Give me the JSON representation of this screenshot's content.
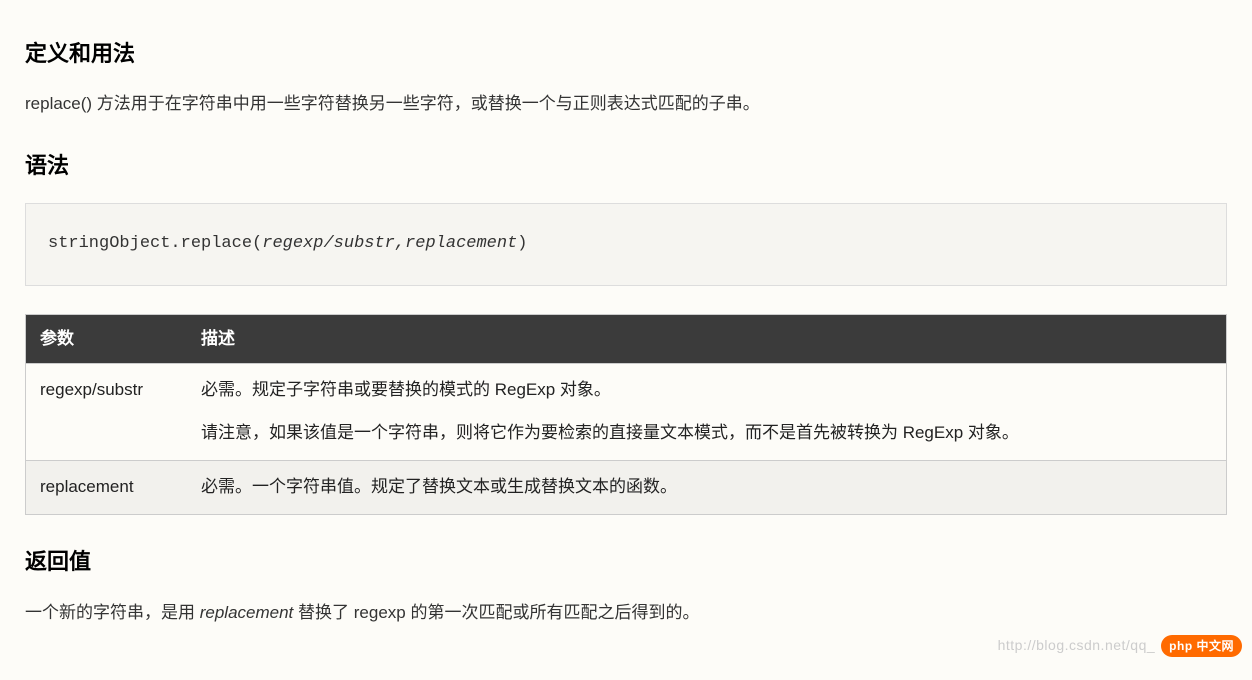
{
  "section1": {
    "heading": "定义和用法",
    "desc": "replace() 方法用于在字符串中用一些字符替换另一些字符，或替换一个与正则表达式匹配的子串。"
  },
  "section2": {
    "heading": "语法",
    "code_prefix": "stringObject.replace(",
    "code_args": "regexp/substr,replacement",
    "code_suffix": ")"
  },
  "table": {
    "header_param": "参数",
    "header_desc": "描述",
    "rows": [
      {
        "param": "regexp/substr",
        "desc1": "必需。规定子字符串或要替换的模式的 RegExp 对象。",
        "desc2": "请注意，如果该值是一个字符串，则将它作为要检索的直接量文本模式，而不是首先被转换为 RegExp 对象。"
      },
      {
        "param": "replacement",
        "desc1": "必需。一个字符串值。规定了替换文本或生成替换文本的函数。",
        "desc2": ""
      }
    ]
  },
  "section3": {
    "heading": "返回值",
    "desc_pre": "一个新的字符串，是用 ",
    "desc_italic": "replacement",
    "desc_post": " 替换了 regexp 的第一次匹配或所有匹配之后得到的。"
  },
  "watermark": {
    "url": "http://blog.csdn.net/qq_",
    "brand": "php 中文网"
  }
}
